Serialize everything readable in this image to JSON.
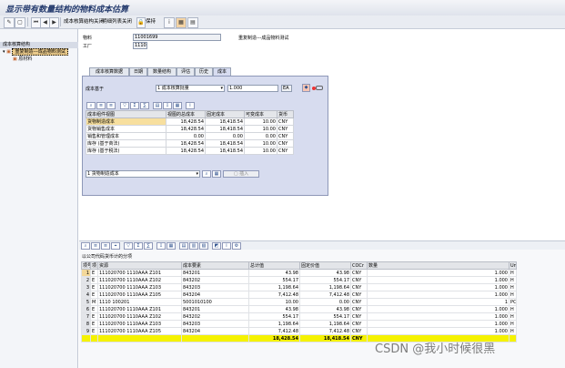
{
  "window": {
    "title": "显示带有数量结构的物料成本估算"
  },
  "toolbar": {
    "items": [
      "成本核算结构关闭",
      "明细列表关闭",
      "保持"
    ]
  },
  "tree": {
    "header": "成本核算结构",
    "root": "重复制造---成品物料测试",
    "child": "原材料"
  },
  "header_fields": {
    "material_label": "物料",
    "material_value": "11001699",
    "material_desc": "重复制造---成品物料测试",
    "plant_label": "工厂",
    "plant_value": "1110"
  },
  "tabs": [
    "成本核算数据",
    "日期",
    "数量结构",
    "评估",
    "历史",
    "成本"
  ],
  "cost_panel": {
    "base_label": "成本基于",
    "base_value": "1 成本核算批量",
    "qty_value": "1.000",
    "unit": "EA",
    "columns": [
      "成本组件视图",
      "视图的总成本",
      "固定成本",
      "可变成本",
      "货币"
    ],
    "rows": [
      [
        "货物制造成本",
        "18,428.54",
        "18,418.54",
        "10.00",
        "CNY"
      ],
      [
        "货物销售成本",
        "18,428.54",
        "18,418.54",
        "10.00",
        "CNY"
      ],
      [
        "销售和管理成本",
        "0.00",
        "0.00",
        "0.00",
        "CNY"
      ],
      [
        "库存 (基于商法)",
        "18,428.54",
        "18,418.54",
        "10.00",
        "CNY"
      ],
      [
        "库存 (基于税法)",
        "18,428.54",
        "18,418.54",
        "10.00",
        "CNY"
      ]
    ],
    "view_select": "1 货物制造成本",
    "insert_label": "插入"
  },
  "items_panel": {
    "caption": "以公司代码货币计的分项",
    "columns": [
      "项号",
      "项",
      "资源",
      "成本要素",
      "总计值",
      "固定价值",
      "COCr",
      "数量",
      "Un"
    ],
    "rows": [
      [
        "1",
        "E",
        "111020700 1110AAA Z101",
        "843201",
        "43.98",
        "43.98",
        "CNY",
        "1.000",
        "H"
      ],
      [
        "2",
        "E",
        "111020700 1110AAA Z102",
        "843202",
        "554.17",
        "554.17",
        "CNY",
        "1.000",
        "H"
      ],
      [
        "3",
        "E",
        "111020700 1110AAA Z103",
        "843203",
        "1,198.64",
        "1,198.64",
        "CNY",
        "1.000",
        "H"
      ],
      [
        "4",
        "E",
        "111020700 1110AAA Z105",
        "843204",
        "7,412.48",
        "7,412.48",
        "CNY",
        "1.000",
        "H"
      ],
      [
        "5",
        "M",
        "1110 100201",
        "5001010100",
        "10.00",
        "0.00",
        "CNY",
        "1",
        "PC"
      ],
      [
        "6",
        "E",
        "111020700 1110AAA Z101",
        "843201",
        "43.98",
        "43.98",
        "CNY",
        "1.000",
        "H"
      ],
      [
        "7",
        "E",
        "111020700 1110AAA Z102",
        "843202",
        "554.17",
        "554.17",
        "CNY",
        "1.000",
        "H"
      ],
      [
        "8",
        "E",
        "111020700 1110AAA Z103",
        "843203",
        "1,198.64",
        "1,198.64",
        "CNY",
        "1.000",
        "H"
      ],
      [
        "9",
        "E",
        "111020700 1110AAA Z105",
        "843204",
        "7,412.48",
        "7,412.48",
        "CNY",
        "1.000",
        "H"
      ]
    ],
    "total": {
      "total": "18,428.54",
      "fixed": "18,418.54",
      "currency": "CNY"
    }
  },
  "watermark": "CSDN @我小时候很黑"
}
